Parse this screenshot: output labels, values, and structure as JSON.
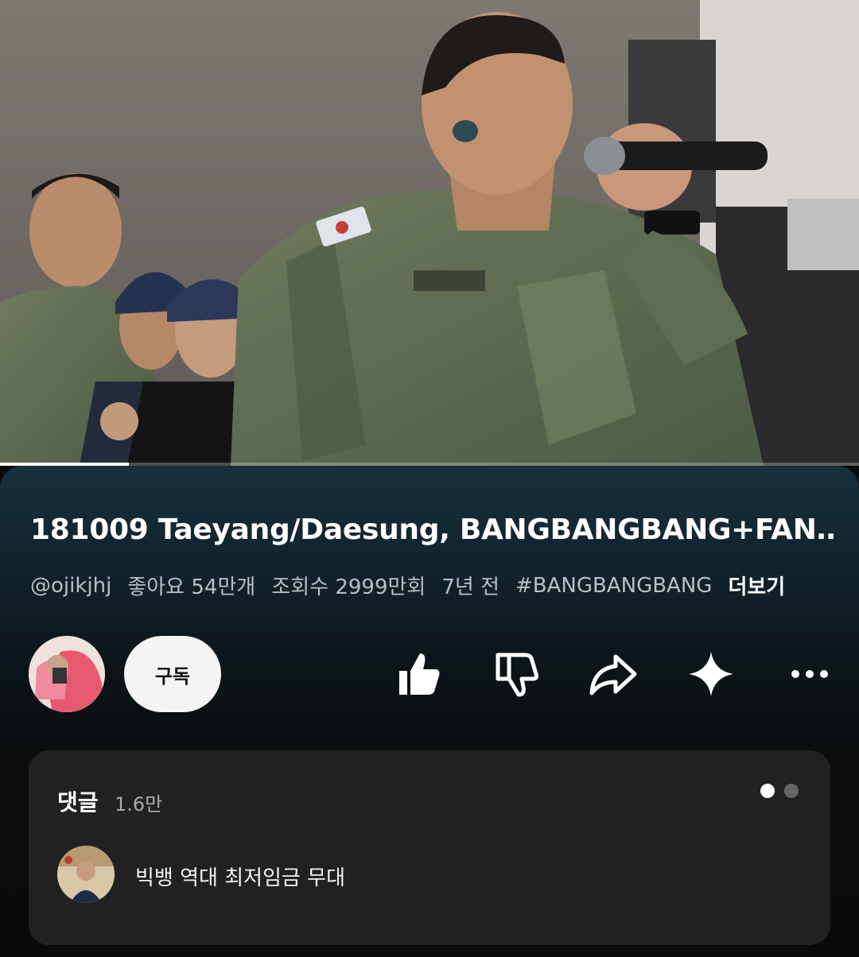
{
  "video": {
    "progress_fraction": 0.15
  },
  "title": "181009 Taeyang/Daesung, BANGBANGBANG+FAN…",
  "meta": {
    "channel": "@ojikjhj",
    "likes": "좋아요 54만개",
    "views": "조회수 2999만회",
    "age": "7년 전",
    "hashtag": "#BANGBANGBANG",
    "more": "더보기"
  },
  "actions": {
    "subscribe_label": "구독",
    "icons": [
      "thumbs-up-icon",
      "thumbs-down-icon",
      "share-icon",
      "sparkle-icon",
      "more-icon"
    ]
  },
  "comments": {
    "title": "댓글",
    "count": "1.6만",
    "top_comment": "빅뱅 역대 최저임금 무대",
    "page_dots": 2,
    "active_dot": 0
  },
  "colors": {
    "panel_top": "#17303d",
    "panel_bottom": "#0a0a0a",
    "card": "#212121",
    "subscribe_bg": "#f4f4f4"
  }
}
